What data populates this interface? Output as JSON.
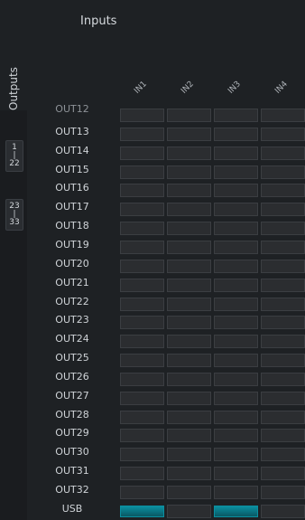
{
  "header": {
    "inputs_title": "Inputs",
    "outputs_title": "Outputs"
  },
  "inputs": [
    "IN1",
    "IN2",
    "IN3",
    "IN4"
  ],
  "range_buttons": [
    {
      "top": "1",
      "sep": "|",
      "bottom": "22"
    },
    {
      "top": "23",
      "sep": "|",
      "bottom": "33"
    }
  ],
  "rows": [
    "OUT12",
    "OUT13",
    "OUT14",
    "OUT15",
    "OUT16",
    "OUT17",
    "OUT18",
    "OUT19",
    "OUT20",
    "OUT21",
    "OUT22",
    "OUT23",
    "OUT24",
    "OUT25",
    "OUT26",
    "OUT27",
    "OUT28",
    "OUT29",
    "OUT30",
    "OUT31",
    "OUT32",
    "USB"
  ],
  "usb_levels": [
    1.0,
    0.0,
    1.0,
    0.0
  ],
  "colors": {
    "meter": "#0b8fa0",
    "cell": "#2b2d30",
    "background": "#1e2124"
  }
}
